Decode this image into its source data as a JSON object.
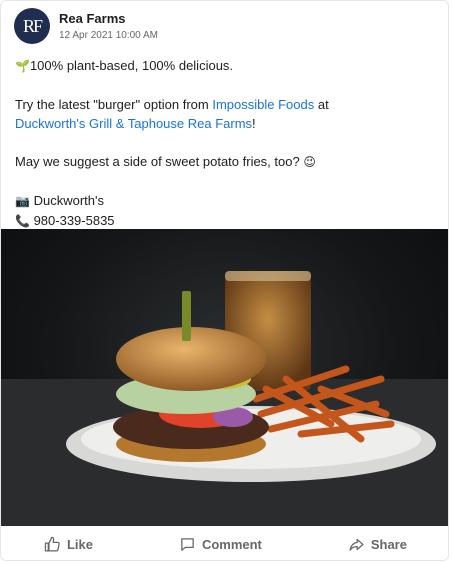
{
  "post": {
    "author": "Rea Farms",
    "avatar_initials": "RF",
    "timestamp": "12 Apr 2021 10:00 AM",
    "line1_icon": "🌱",
    "line1_text": "100% plant-based, 100% delicious.",
    "line2_pre": "Try the latest \"burger\" option from ",
    "line2_link1": "Impossible Foods",
    "line2_mid": " at",
    "line2_link2": "Duckworth's Grill & Taphouse Rea Farms",
    "line2_post": "!",
    "line3_text": "May we suggest a side of sweet potato fries, too?",
    "line3_emoji": "😉",
    "line4_icon": "📷",
    "line4_text": "Duckworth's",
    "line5_icon": "📞",
    "line5_text": "980-339-5835"
  },
  "actions": {
    "like": "Like",
    "comment": "Comment",
    "share": "Share"
  },
  "colors": {
    "link": "#1a73d9",
    "avatar_bg": "#1f2d4f",
    "muted": "#65676b"
  }
}
